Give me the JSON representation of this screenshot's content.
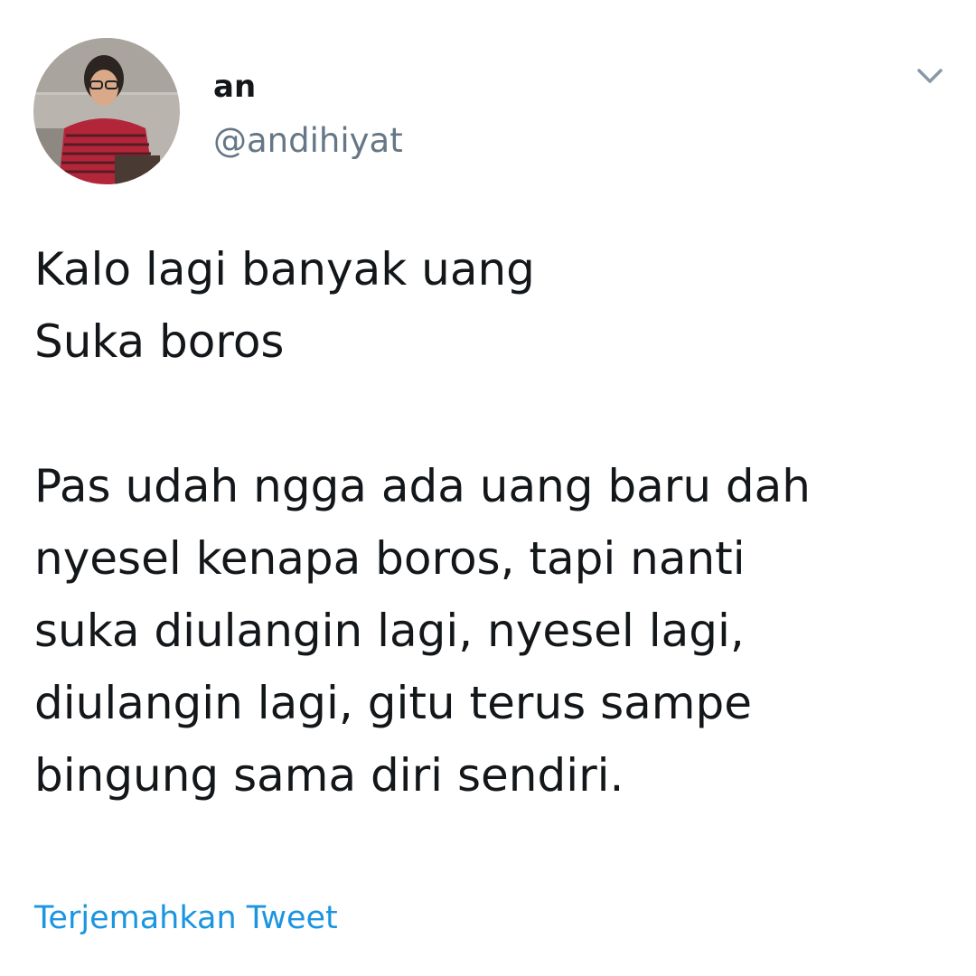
{
  "author": {
    "display_name": "an",
    "handle": "@andihiyat"
  },
  "tweet": {
    "paragraph1": [
      "Kalo lagi banyak uang",
      "Suka boros"
    ],
    "paragraph2": [
      "Pas udah ngga ada uang baru dah",
      "nyesel kenapa boros, tapi nanti",
      "suka diulangin lagi, nyesel lagi,",
      "diulangin lagi, gitu terus sampe",
      "bingung sama diri sendiri."
    ]
  },
  "actions": {
    "translate_label": "Terjemahkan Tweet"
  },
  "icons": {
    "menu": "chevron-down-icon",
    "avatar": "profile-photo"
  },
  "colors": {
    "text": "#14171a",
    "secondary": "#657786",
    "link": "#1b95e0",
    "caret": "#8899a6"
  }
}
